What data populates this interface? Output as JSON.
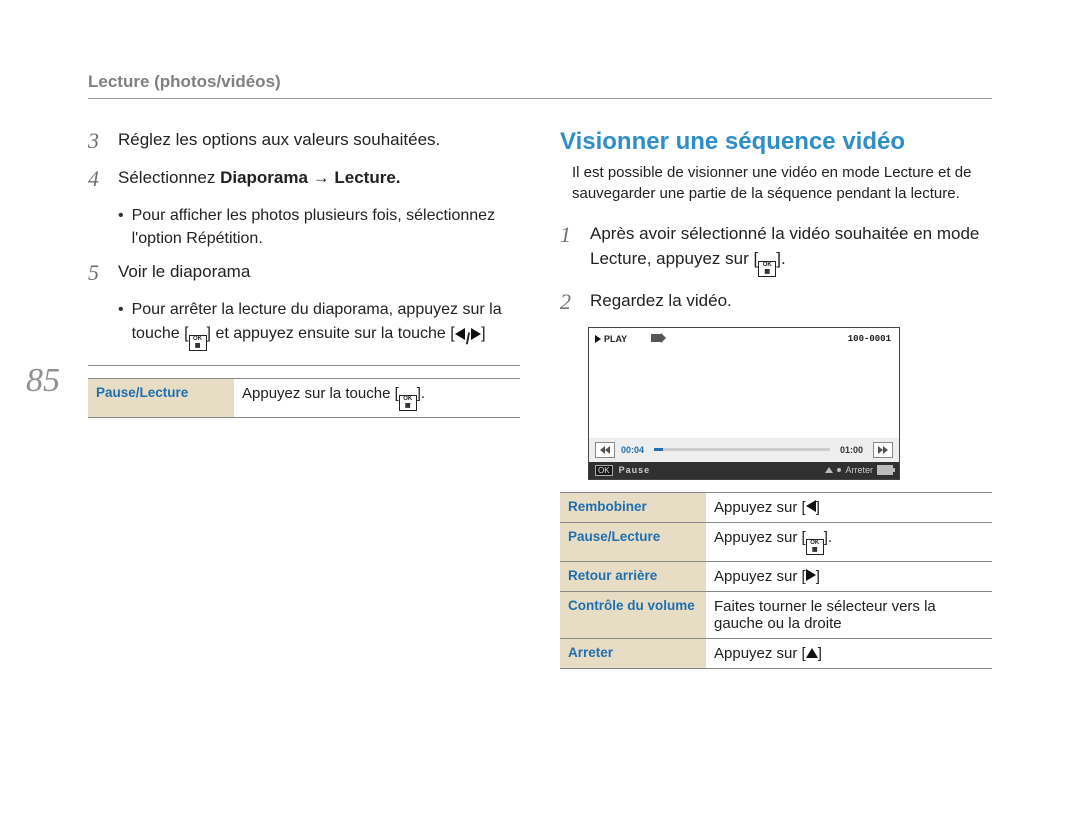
{
  "header": {
    "title": "Lecture (photos/vidéos)"
  },
  "page_number": "85",
  "left": {
    "step3": {
      "num": "3",
      "text": "Réglez les options aux valeurs souhaitées."
    },
    "step4": {
      "num": "4",
      "text_pre": "Sélectionnez ",
      "text_bold": "Diaporama → Lecture.",
      "bullet_pre": "Pour afficher les photos plusieurs fois, sélectionnez l'option ",
      "bullet_bold": "Répétition",
      "bullet_post": "."
    },
    "step5": {
      "num": "5",
      "text": "Voir le diaporama",
      "bullet_a": "Pour arrêter la lecture du diaporama, appuyez sur la touche [",
      "bullet_b": "] et appuyez ensuite sur la touche [",
      "bullet_c": "]"
    },
    "table": {
      "row1": {
        "key": "Pause/Lecture",
        "val_a": "Appuyez sur la touche [",
        "val_b": "]."
      }
    }
  },
  "right": {
    "title": "Visionner une séquence vidéo",
    "intro": "Il est possible de visionner une vidéo en mode Lecture et de sauvegarder une partie de la séquence pendant la lecture.",
    "step1": {
      "num": "1",
      "a": "Après avoir sélectionné la vidéo souhaitée en mode Lecture, appuyez sur [",
      "b": "]."
    },
    "step2": {
      "num": "2",
      "text": "Regardez la vidéo."
    },
    "preview": {
      "play_label": "PLAY",
      "file_id": "100-0001",
      "time_current": "00:04",
      "time_total": "01:00",
      "ok": "OK",
      "pause": "Pause",
      "stop": "Arreter"
    },
    "table": {
      "r1": {
        "key": "Rembobiner",
        "val": "Appuyez sur [",
        "tail": "]"
      },
      "r2": {
        "key": "Pause/Lecture",
        "val": "Appuyez sur [",
        "tail": "]."
      },
      "r3": {
        "key": "Retour arrière",
        "val": "Appuyez sur [",
        "tail": "]"
      },
      "r4": {
        "key": "Contrôle du volume",
        "val": "Faites tourner le sélecteur vers la gauche ou la droite"
      },
      "r5": {
        "key": "Arreter",
        "val": "Appuyez sur [",
        "tail": "]"
      }
    }
  }
}
